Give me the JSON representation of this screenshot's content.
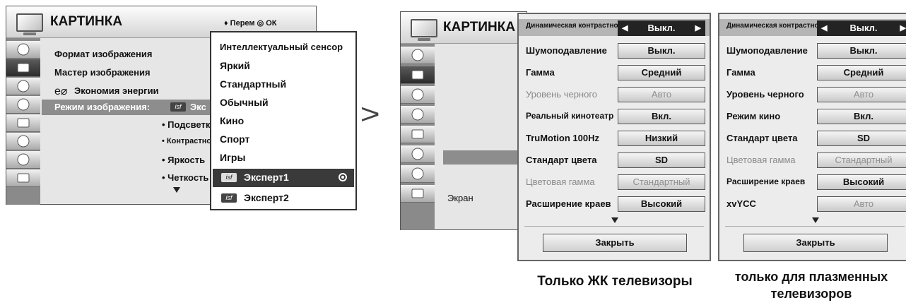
{
  "menu1": {
    "title": "КАРТИНКА",
    "items": [
      "Формат изображения",
      "Мастер изображения",
      "Экономия энергии"
    ],
    "eco_symbol": "e⌀",
    "picture_mode_label": "Режим изображения:",
    "picture_mode_value": "Экс",
    "sub_items": [
      "• Подсветка",
      "• Контрастность",
      "• Яркость",
      "• Четкость"
    ],
    "hint": "♦ Перем  ◎ ОК"
  },
  "dropdown": {
    "options": [
      "Интеллектуальный сенсор",
      "Яркий",
      "Стандартный",
      "Обычный",
      "Кино",
      "Спорт",
      "Игры"
    ],
    "expert1": "Эксперт1",
    "expert2": "Эксперт2",
    "selected": "Эксперт1"
  },
  "arrow_symbol": ">",
  "menu2": {
    "title": "КАРТИНКА",
    "item": "Экран"
  },
  "lcd": {
    "rows": [
      {
        "label": "Динамическая контрастность",
        "value": "Выкл."
      },
      {
        "label": "Шумоподавление",
        "value": "Выкл."
      },
      {
        "label": "Гамма",
        "value": "Средний"
      },
      {
        "label": "Уровень черного",
        "value": "Авто"
      },
      {
        "label": "Реальный кинотеатр",
        "value": "Вкл."
      },
      {
        "label": "TruMotion 100Hz",
        "value": "Низкий"
      },
      {
        "label": "Стандарт цвета",
        "value": "SD"
      },
      {
        "label": "Цветовая гамма",
        "value": "Стандартный"
      },
      {
        "label": "Расширение краев",
        "value": "Высокий"
      }
    ],
    "close": "Закрыть",
    "caption": "Только ЖК телевизоры"
  },
  "plasma": {
    "rows": [
      {
        "label": "Динамическая контрастность",
        "value": "Выкл."
      },
      {
        "label": "Шумоподавление",
        "value": "Выкл."
      },
      {
        "label": "Гамма",
        "value": "Средний"
      },
      {
        "label": "Уровень черного",
        "value": "Авто"
      },
      {
        "label": "Режим кино",
        "value": "Вкл."
      },
      {
        "label": "Стандарт цвета",
        "value": "SD"
      },
      {
        "label": "Цветовая гамма",
        "value": "Стандартный"
      },
      {
        "label": "Расширение краев",
        "value": "Высокий"
      },
      {
        "label": "xvYCC",
        "value": "Авто"
      }
    ],
    "close": "Закрыть",
    "caption_line1": "только для плазменных",
    "caption_line2": "телевизоров"
  },
  "colors": {
    "selected_row": "#8d8d8d",
    "active_value": "#232323",
    "dim_text": "#8a8a8a"
  }
}
